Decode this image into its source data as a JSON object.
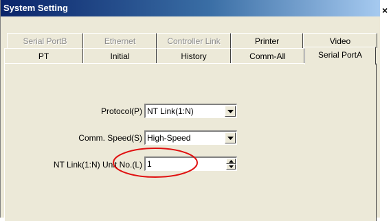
{
  "window": {
    "title": "System Setting",
    "close_glyph": "×"
  },
  "tabs_row1": [
    {
      "label": "Serial PortB"
    },
    {
      "label": "Ethernet"
    },
    {
      "label": "Controller Link"
    },
    {
      "label": "Printer"
    },
    {
      "label": "Video"
    }
  ],
  "tabs_row2": [
    {
      "label": "PT"
    },
    {
      "label": "Initial"
    },
    {
      "label": "History"
    },
    {
      "label": "Comm-All"
    },
    {
      "label": "Serial PortA"
    }
  ],
  "form": {
    "protocol_label": "Protocol(P)",
    "protocol_value": "NT Link(1:N)",
    "speed_label": "Comm. Speed(S)",
    "speed_value": "High-Speed",
    "unit_label": "NT Link(1:N) Unit No.(L)",
    "unit_value": "1"
  },
  "colors": {
    "annotation": "#e01010",
    "titlebar": "#0a246a"
  }
}
